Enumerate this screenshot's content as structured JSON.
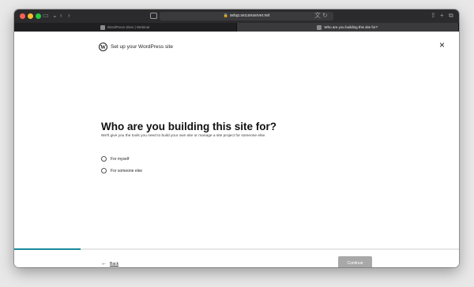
{
  "browser": {
    "url": "setup.secureserver.net",
    "tabs": [
      {
        "label": "WordPress Sites | Webinar",
        "active": false
      },
      {
        "label": "Who are you building this site for?",
        "active": true
      }
    ]
  },
  "header": {
    "title": "Set up your WordPress site",
    "logo_letter": "W"
  },
  "main": {
    "heading": "Who are you building this site for?",
    "subheading": "We'll give you the tools you need to build your own site or manage a site project for someone else.",
    "options": [
      {
        "label": "For myself",
        "selected": false
      },
      {
        "label": "For someone else",
        "selected": false
      }
    ]
  },
  "progress": {
    "fraction": 0.15
  },
  "footer": {
    "back_label": "Back",
    "continue_label": "Continue",
    "continue_enabled": false
  },
  "colors": {
    "accent": "#1a8a9e",
    "button_disabled": "#a8a8a8"
  }
}
